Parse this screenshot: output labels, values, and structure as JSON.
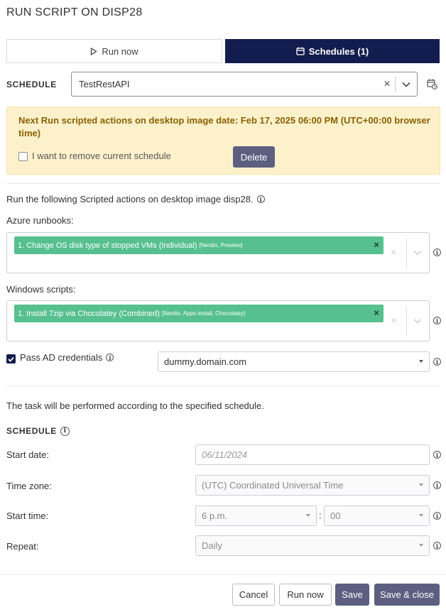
{
  "title": "RUN SCRIPT ON DISP28",
  "tabs": {
    "run_now": "Run now",
    "schedules": "Schedules (1)"
  },
  "schedule": {
    "label": "SCHEDULE",
    "selected": "TestRestAPI"
  },
  "warning": {
    "text": "Next Run scripted actions on desktop image date: Feb 17, 2025 06:00 PM (UTC+00:00 browser time)",
    "remove_label": "I want to remove current schedule",
    "delete_label": "Delete"
  },
  "intro": "Run the following Scripted actions on desktop image disp28.",
  "azure": {
    "label": "Azure runbooks:",
    "chip_main": "1. Change OS disk type of stopped VMs (Individual)",
    "chip_tags": "[Nerdio, Preview]"
  },
  "windows": {
    "label": "Windows scripts:",
    "chip_main": "1. Install 7zip via Chocolatey (Combined)",
    "chip_tags": "[Nerdio, Apps install, Chocolatey]"
  },
  "ad": {
    "label": "Pass AD credentials",
    "checked": true,
    "domain": "dummy.domain.com"
  },
  "task_note": "The task will be performed according to the specified schedule.",
  "schedule2": {
    "heading": "SCHEDULE",
    "start_date_label": "Start date:",
    "start_date": "06/11/2024",
    "tz_label": "Time zone:",
    "tz": "(UTC) Coordinated Universal Time",
    "start_time_label": "Start time:",
    "hour": "6 p.m.",
    "minute": "00",
    "repeat_label": "Repeat:",
    "repeat": "Daily"
  },
  "footer": {
    "cancel": "Cancel",
    "run_now": "Run now",
    "save": "Save",
    "save_close": "Save & close"
  },
  "colors": {
    "primary": "#131c4e",
    "chip": "#56c08e",
    "warning_bg": "#fdf1cc",
    "warning_text": "#8a6200",
    "button": "#5c5f80"
  }
}
